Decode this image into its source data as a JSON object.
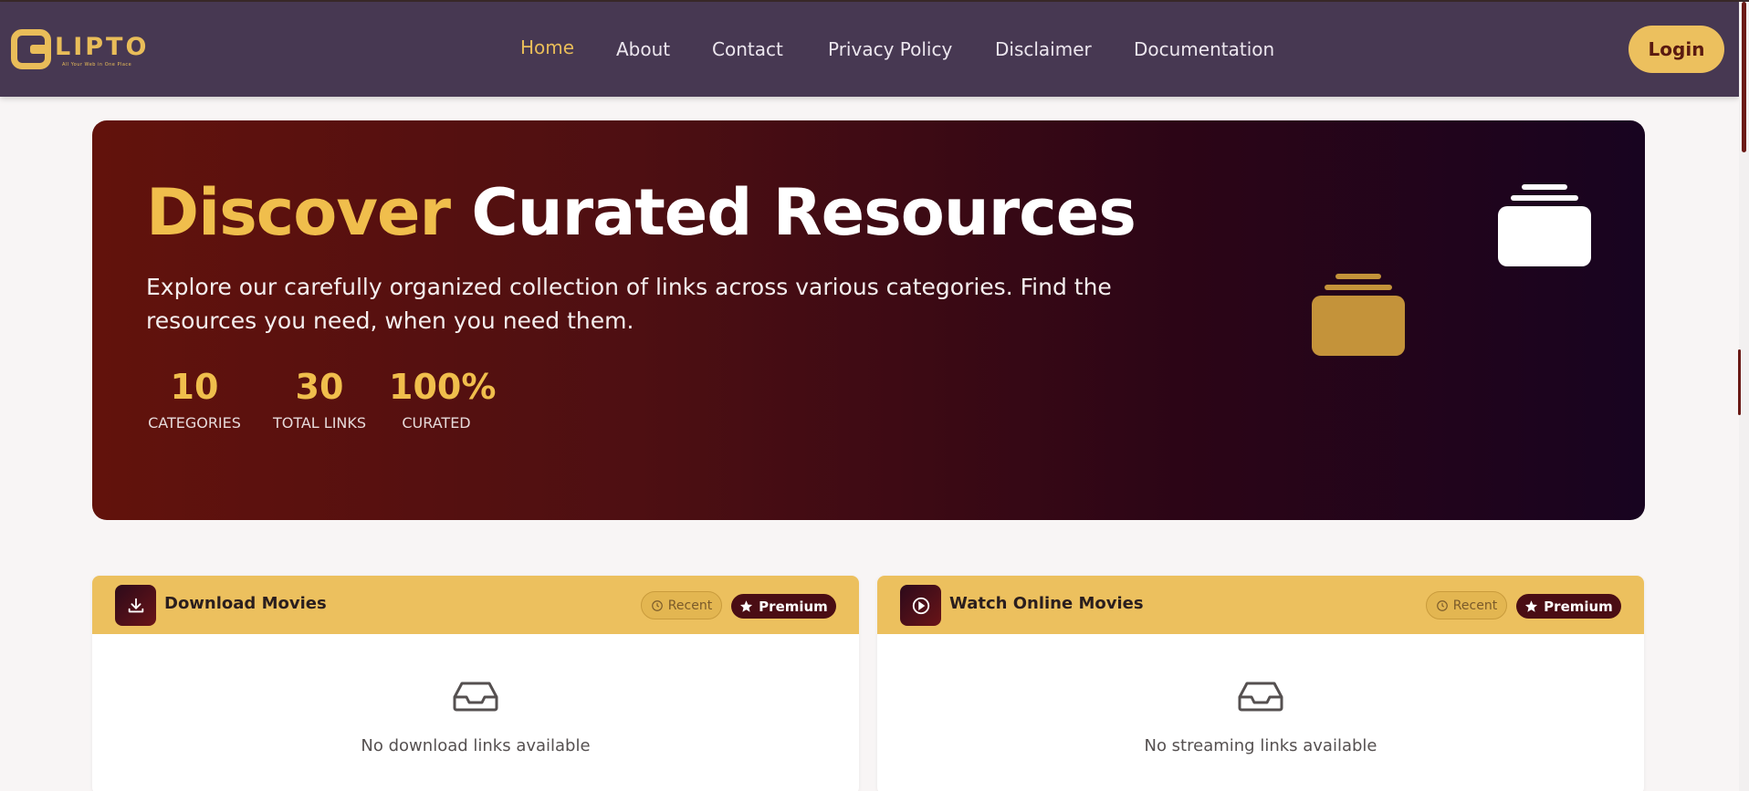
{
  "brand": {
    "name": "LIPTO",
    "tagline": "All Your Web in One Place",
    "color": "#e9bd59"
  },
  "nav": {
    "items": [
      {
        "label": "Home",
        "active": true
      },
      {
        "label": "About",
        "active": false
      },
      {
        "label": "Contact",
        "active": false
      },
      {
        "label": "Privacy Policy",
        "active": false
      },
      {
        "label": "Disclaimer",
        "active": false
      },
      {
        "label": "Documentation",
        "active": false
      }
    ],
    "login_label": "Login"
  },
  "hero": {
    "title_accent": "Discover",
    "title_main": "Curated Resources",
    "subtitle": "Explore our carefully organized collection of links across various categories. Find the resources you need, when you need them.",
    "stats": [
      {
        "value": "10",
        "label": "CATEGORIES"
      },
      {
        "value": "30",
        "label": "TOTAL LINKS"
      },
      {
        "value": "100%",
        "label": "CURATED"
      }
    ],
    "icons": [
      "inbox-stack-white-icon",
      "inbox-stack-gold-icon"
    ]
  },
  "cards": [
    {
      "title": "Download Movies",
      "icon": "download-icon",
      "recent_label": "Recent",
      "premium_label": "Premium",
      "empty_icon": "inbox-icon",
      "empty_text": "No download links available"
    },
    {
      "title": "Watch Online Movies",
      "icon": "play-circle-icon",
      "recent_label": "Recent",
      "premium_label": "Premium",
      "empty_icon": "inbox-icon",
      "empty_text": "No streaming links available"
    }
  ],
  "colors": {
    "nav_bg": "#473852",
    "accent_gold": "#f0be4c",
    "hero_start": "#62120c",
    "hero_end": "#180420",
    "premium_bg": "#4a0d14"
  }
}
